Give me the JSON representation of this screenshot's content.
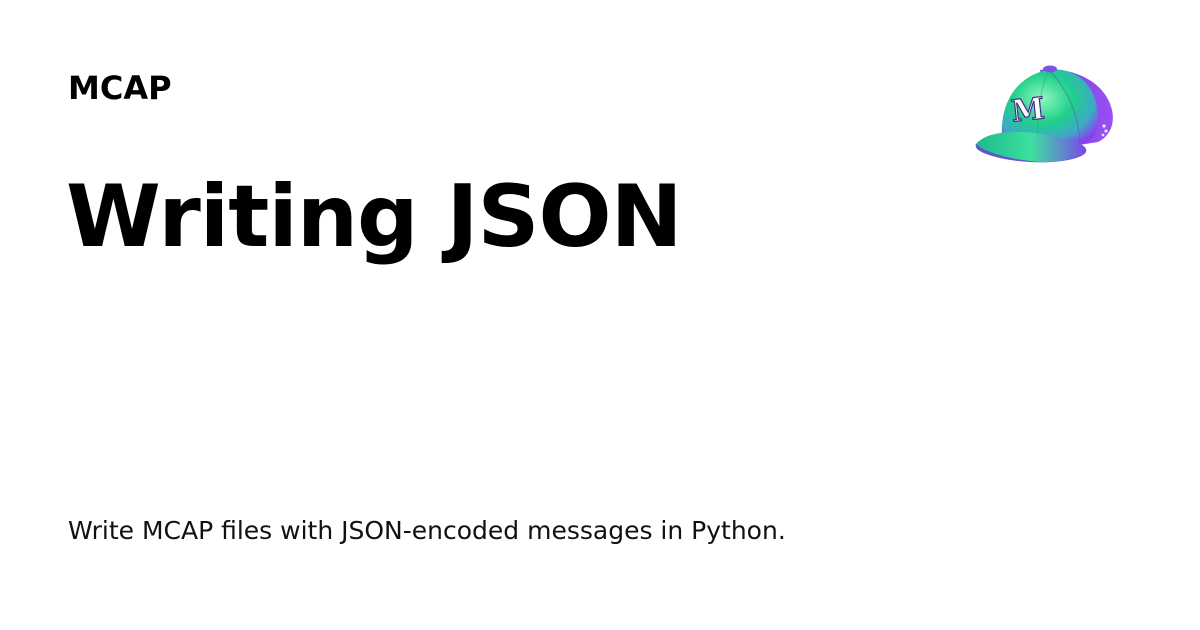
{
  "header": {
    "brand": "MCAP"
  },
  "main": {
    "title": "Writing JSON",
    "description": "Write MCAP files with JSON-encoded messages in Python."
  },
  "logo": {
    "icon": "mcap-cap-icon",
    "letter": "M",
    "colors": {
      "crown_top": "#6cf2a6",
      "crown_mid": "#1fd08a",
      "crown_side": "#8a3ff0",
      "brim": "#22c98a",
      "brim_edge": "#7a38e8",
      "letter_fill": "#ffffff",
      "letter_stroke": "#4a2a8a"
    }
  }
}
